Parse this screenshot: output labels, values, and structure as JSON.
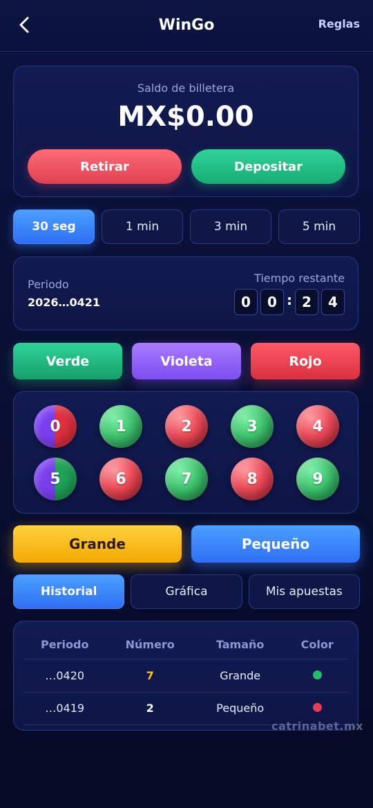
{
  "header": {
    "title": "WinGo",
    "rules_label": "Reglas"
  },
  "wallet": {
    "label": "Saldo de billetera",
    "amount": "MX$0.00",
    "withdraw_label": "Retirar",
    "deposit_label": "Depositar"
  },
  "time_tabs": [
    {
      "label": "30 seg",
      "active": true
    },
    {
      "label": "1 min",
      "active": false
    },
    {
      "label": "3 min",
      "active": false
    },
    {
      "label": "5 min",
      "active": false
    }
  ],
  "period": {
    "label": "Periodo",
    "value": "2026…0421",
    "remaining_label": "Tiempo restante",
    "digits": [
      "0",
      "0",
      "2",
      "4"
    ]
  },
  "colors": {
    "green_label": "Verde",
    "violet_label": "Violeta",
    "red_label": "Rojo",
    "green": "#1fbf7f",
    "violet": "#8a5cf5",
    "red": "#e63e4e"
  },
  "numbers": [
    {
      "value": "0",
      "color": "violet-red"
    },
    {
      "value": "1",
      "color": "green"
    },
    {
      "value": "2",
      "color": "red"
    },
    {
      "value": "3",
      "color": "green"
    },
    {
      "value": "4",
      "color": "red"
    },
    {
      "value": "5",
      "color": "violet-green"
    },
    {
      "value": "6",
      "color": "red"
    },
    {
      "value": "7",
      "color": "green"
    },
    {
      "value": "8",
      "color": "red"
    },
    {
      "value": "9",
      "color": "green"
    }
  ],
  "size": {
    "big_label": "Grande",
    "small_label": "Pequeño"
  },
  "history_tabs": [
    {
      "label": "Historial",
      "active": true
    },
    {
      "label": "Gráfica",
      "active": false
    },
    {
      "label": "Mis apuestas",
      "active": false
    }
  ],
  "history_table": {
    "headers": [
      "Periodo",
      "Número",
      "Tamaño",
      "Color"
    ],
    "rows": [
      {
        "period": "…0420",
        "number": "7",
        "size": "Grande",
        "color": "green"
      },
      {
        "period": "…0419",
        "number": "2",
        "size": "Pequeño",
        "color": "red"
      }
    ]
  },
  "watermark": "catrinabet.mx"
}
